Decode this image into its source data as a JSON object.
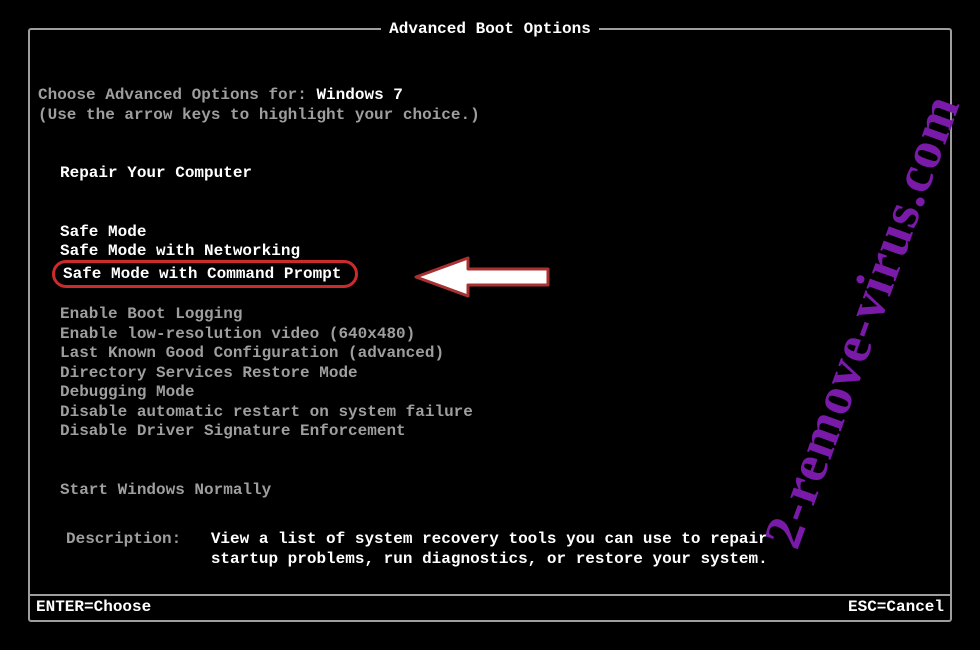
{
  "title": "Advanced Boot Options",
  "choose_prefix": "Choose Advanced Options for: ",
  "os_name": "Windows 7",
  "hint": "(Use the arrow keys to highlight your choice.)",
  "repair": "Repair Your Computer",
  "options": {
    "safe_mode": "Safe Mode",
    "safe_mode_net": "Safe Mode with Networking",
    "safe_mode_cmd": "Safe Mode with Command Prompt",
    "boot_logging": "Enable Boot Logging",
    "low_res": "Enable low-resolution video (640x480)",
    "lkgc": "Last Known Good Configuration (advanced)",
    "ds_restore": "Directory Services Restore Mode",
    "debug": "Debugging Mode",
    "no_auto_restart": "Disable automatic restart on system failure",
    "no_drv_sig": "Disable Driver Signature Enforcement",
    "start_normal": "Start Windows Normally"
  },
  "description_label": "Description:",
  "description_text1": "View a list of system recovery tools you can use to repair",
  "description_text2": "startup problems, run diagnostics, or restore your system.",
  "footer": {
    "enter": "ENTER=Choose",
    "esc": "ESC=Cancel"
  },
  "watermark": "2-remove-virus.com",
  "colors": {
    "highlight_border": "#cc2b2b",
    "watermark": "#7a1aa8"
  }
}
